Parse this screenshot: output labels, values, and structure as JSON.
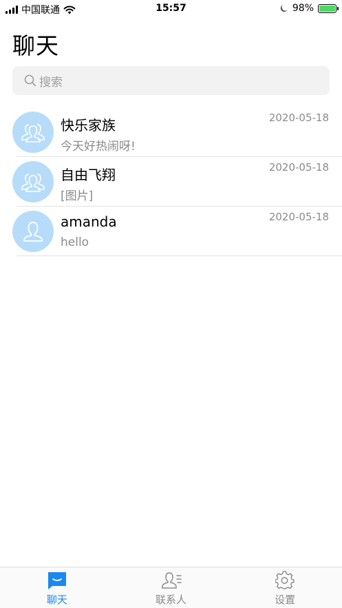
{
  "status_bar": {
    "carrier": "中国联通",
    "time": "15:57",
    "battery_percent": "98%",
    "battery_level": 0.98
  },
  "header": {
    "title": "聊天"
  },
  "search": {
    "placeholder": "搜索"
  },
  "chats": [
    {
      "name": "快乐家族",
      "preview": "今天好热闹呀!",
      "date": "2020-05-18",
      "avatar_icon": "group-avatar-icon"
    },
    {
      "name": "自由飞翔",
      "preview": "[图片]",
      "date": "2020-05-18",
      "avatar_icon": "group-avatar-icon"
    },
    {
      "name": "amanda",
      "preview": "hello",
      "date": "2020-05-18",
      "avatar_icon": "person-avatar-icon"
    }
  ],
  "tabs": [
    {
      "label": "聊天",
      "icon": "chat-icon",
      "active": true
    },
    {
      "label": "联系人",
      "icon": "contacts-icon",
      "active": false
    },
    {
      "label": "设置",
      "icon": "settings-icon",
      "active": false
    }
  ],
  "colors": {
    "accent": "#1b88f0",
    "avatar_bg": "#b7dcfa",
    "battery": "#4cd964"
  }
}
